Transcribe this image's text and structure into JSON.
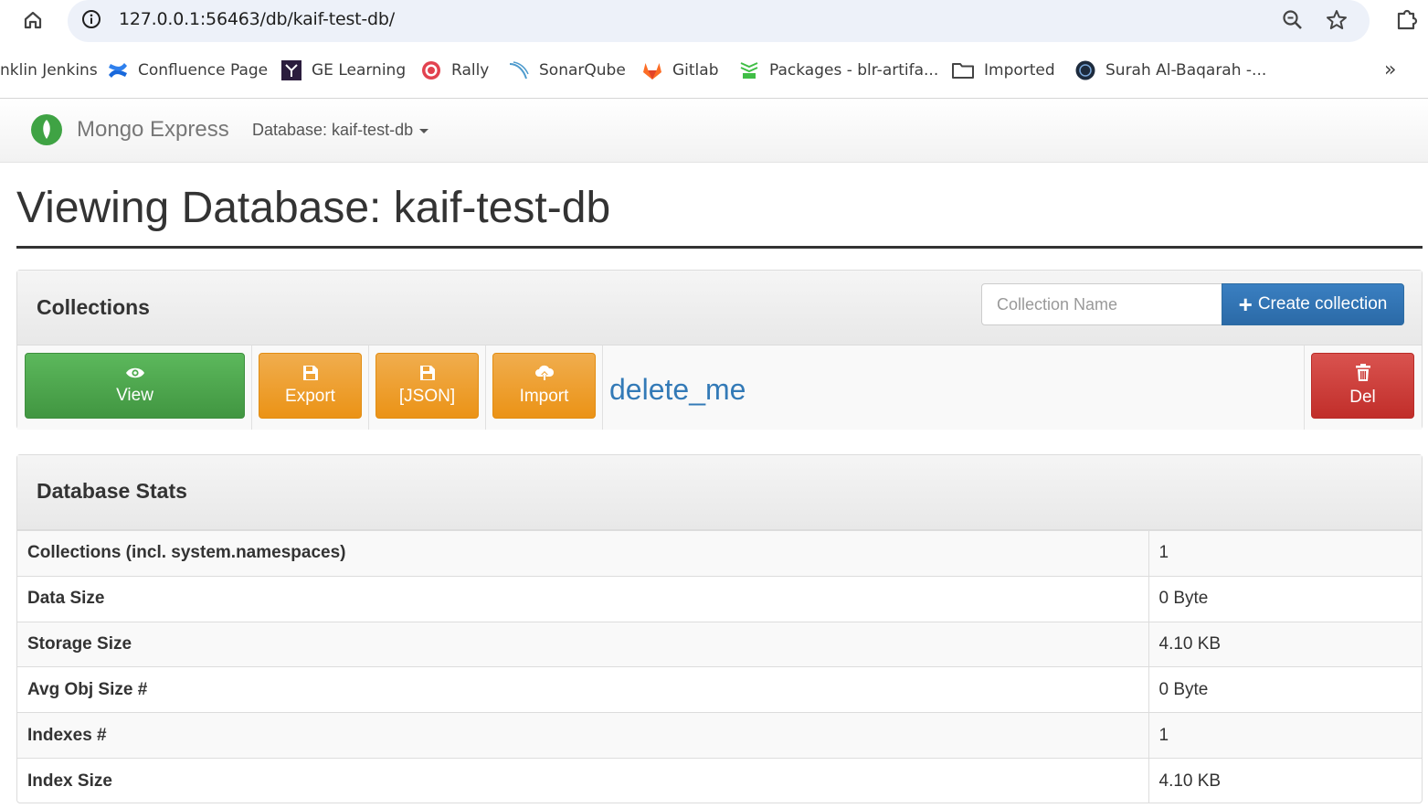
{
  "browser": {
    "url": "127.0.0.1:56463/db/kaif-test-db/",
    "bookmarks": [
      {
        "label": "nklin Jenkins",
        "icon": "jenkins-icon"
      },
      {
        "label": "Confluence Page",
        "icon": "confluence-icon"
      },
      {
        "label": "GE Learning",
        "icon": "ge-learning-icon"
      },
      {
        "label": "Rally",
        "icon": "rally-icon"
      },
      {
        "label": "SonarQube",
        "icon": "sonarqube-icon"
      },
      {
        "label": "Gitlab",
        "icon": "gitlab-icon"
      },
      {
        "label": "Packages - blr-artifa...",
        "icon": "jfrog-icon"
      },
      {
        "label": "Imported",
        "icon": "folder-icon"
      },
      {
        "label": "Surah Al-Baqarah -...",
        "icon": "quran-icon"
      }
    ],
    "more_label": "»"
  },
  "navbar": {
    "brand": "Mongo Express",
    "db_dropdown": "Database: kaif-test-db"
  },
  "page": {
    "title": "Viewing Database: kaif-test-db"
  },
  "collections": {
    "heading": "Collections",
    "new_name_placeholder": "Collection Name",
    "create_label": "Create collection",
    "items": [
      {
        "name": "delete_me",
        "view_label": "View",
        "export_label": "Export",
        "json_label": "[JSON]",
        "import_label": "Import",
        "delete_label": "Del"
      }
    ]
  },
  "stats": {
    "heading": "Database Stats",
    "rows": [
      {
        "label": "Collections (incl. system.namespaces)",
        "value": "1"
      },
      {
        "label": "Data Size",
        "value": "0 Byte"
      },
      {
        "label": "Storage Size",
        "value": "4.10 KB"
      },
      {
        "label": "Avg Obj Size #",
        "value": "0 Byte"
      },
      {
        "label": "Indexes #",
        "value": "1"
      },
      {
        "label": "Index Size",
        "value": "4.10 KB"
      }
    ]
  },
  "colors": {
    "brand_green": "#3fa344",
    "primary": "#337ab7",
    "success": "#5cb85c",
    "warning": "#f0ad4e",
    "danger": "#d9534f"
  }
}
